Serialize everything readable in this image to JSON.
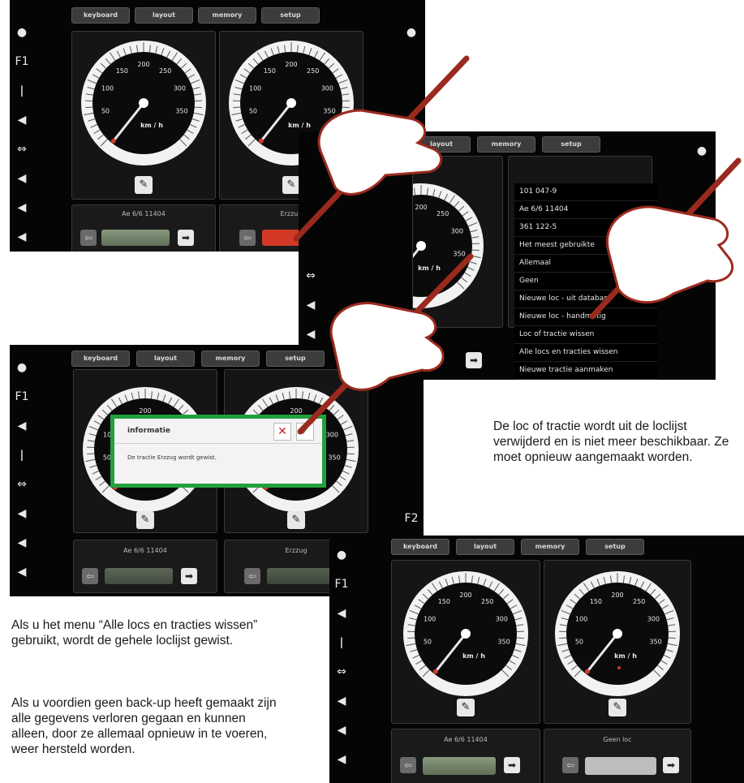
{
  "top_tabs": {
    "keyboard": "keyboard",
    "layout": "layout",
    "memory": "memory",
    "setup": "setup"
  },
  "speedo_labels": {
    "kmh": "km / h",
    "t50": "50",
    "t100": "100",
    "t150": "150",
    "t200": "200",
    "t250": "250",
    "t300": "300",
    "t350": "350"
  },
  "screen1": {
    "loc_left": "Ae 6/6 11404",
    "loc_right": "Erzzug"
  },
  "screen2": {
    "menu_items": [
      "101 047-9",
      "Ae 6/6 11404",
      "361 122-5",
      "Het meest gebruikte",
      "Allemaal",
      "Geen",
      "Nieuwe loc - uit database",
      "Nieuwe loc - handmatig",
      "Loc of tractie wissen",
      "Alle locs en tracties wissen",
      "Nieuwe tractie aanmaken"
    ]
  },
  "screen3": {
    "dialog_title": "informatie",
    "dialog_text": "De tractie Erzzug wordt gewist.",
    "loc_left": "Ae 6/6 11404",
    "loc_right": "Erzzug"
  },
  "screen4": {
    "loc_left": "Ae 6/6 11404",
    "loc_right": "Geen loc"
  },
  "text_right": "De loc of tractie wordt uit de loclijst verwijderd en is niet meer beschikbaar. Ze moet opnieuw aangemaakt worden.",
  "text_left_1": "Als u het menu “Alle locs en tracties wissen” gebruikt, wordt de gehele loclijst gewist.",
  "text_left_2": "Als u voordien geen back-up heeft gemaakt zijn alle gegevens verloren gegaan en kunnen alleen, door ze allemaal opnieuw in te voeren, weer hersteld worden.",
  "icons": [
    "light-icon",
    "function-icon",
    "horn-icon",
    "whistle-icon",
    "car-icon",
    "wrench-icon",
    "arrow-left-icon",
    "arrow-right-icon",
    "close-icon",
    "check-icon",
    "stylus-hand-icon"
  ],
  "colors": {
    "screen_bg": "#050505",
    "accent_red": "#d03a24",
    "dialog_green": "#22a040",
    "hand_outline": "#9b2a1e"
  }
}
